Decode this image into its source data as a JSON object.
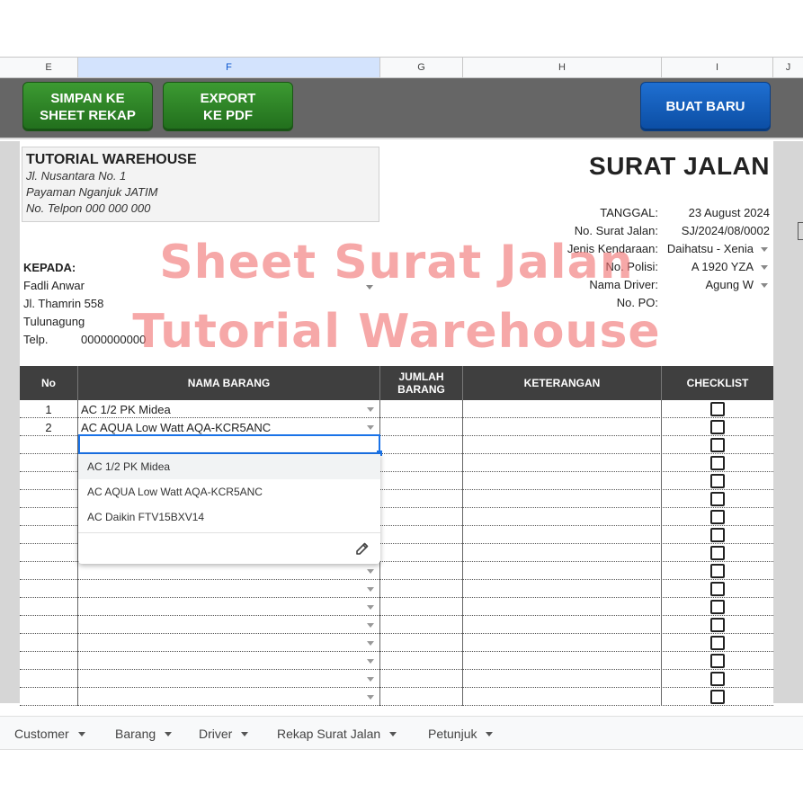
{
  "columns": [
    "E",
    "F",
    "G",
    "H",
    "I",
    "J"
  ],
  "buttons": {
    "save": "SIMPAN KE\nSHEET REKAP",
    "export": "EXPORT\nKE PDF",
    "new": "BUAT BARU"
  },
  "company": {
    "name": "TUTORIAL WAREHOUSE",
    "address": "Jl. Nusantara No. 1",
    "city": "Payaman Nganjuk JATIM",
    "phone": "No. Telpon 000 000 000"
  },
  "doc_title": "SURAT JALAN",
  "meta": {
    "tanggal_label": "TANGGAL:",
    "tanggal_value": "23 August 2024",
    "nomor_label": "No. Surat Jalan:",
    "nomor_value": "SJ/2024/08/0002",
    "kendaraan_label": "Jenis Kendaraan:",
    "kendaraan_value": "Daihatsu - Xenia",
    "polisi_label": "No. Polisi:",
    "polisi_value": "A 1920 YZA",
    "driver_label": "Nama Driver:",
    "driver_value": "Agung W",
    "po_label": "No. PO:"
  },
  "customer": {
    "kepada_label": "KEPADA:",
    "name": "Fadli Anwar",
    "address": "Jl. Thamrin 558",
    "city": "Tulunagung",
    "telp_label": "Telp.",
    "telp_value": "0000000000"
  },
  "watermark": {
    "line1": "Sheet Surat Jalan",
    "line2": "Tutorial Warehouse"
  },
  "table": {
    "headers": {
      "no": "No",
      "nama": "NAMA BARANG",
      "jumlah": "JUMLAH\nBARANG",
      "keterangan": "KETERANGAN",
      "checklist": "CHECKLIST"
    },
    "rows": [
      {
        "no": "1",
        "nama": "AC 1/2 PK Midea"
      },
      {
        "no": "2",
        "nama": "AC AQUA Low Watt AQA-KCR5ANC"
      }
    ]
  },
  "dropdown": {
    "options": [
      "AC 1/2 PK Midea",
      "AC AQUA Low Watt AQA-KCR5ANC",
      "AC Daikin FTV15BXV14"
    ]
  },
  "tabs": [
    "Customer",
    "Barang",
    "Driver",
    "Rekap Surat Jalan",
    "Petunjuk"
  ]
}
